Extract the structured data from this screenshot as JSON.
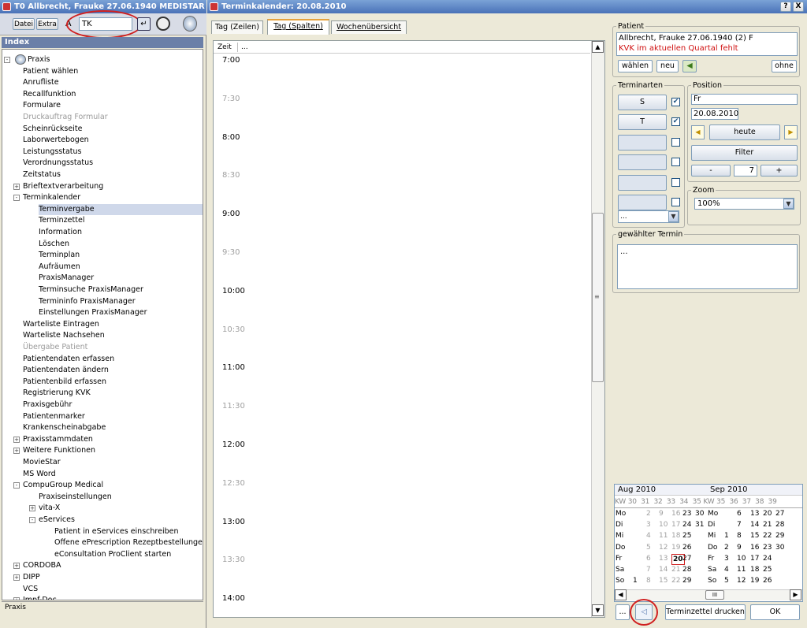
{
  "left_window": {
    "title": "T0 Allbrecht, Frauke 27.06.1940 MEDISTAR",
    "menu": [
      "Datei",
      "Extra"
    ],
    "search_value": "TK",
    "index_title": "Index",
    "status": "Praxis",
    "tree": [
      {
        "label": "Praxis",
        "level": 0,
        "expand": "-",
        "icon": "globe-icon"
      },
      {
        "label": "Patient wählen",
        "level": 1
      },
      {
        "label": "Anrufliste",
        "level": 1
      },
      {
        "label": "Recallfunktion",
        "level": 1
      },
      {
        "label": "Formulare",
        "level": 1
      },
      {
        "label": "Druckauftrag Formular",
        "level": 1,
        "disabled": true
      },
      {
        "label": "Scheinrückseite",
        "level": 1
      },
      {
        "label": "Laborwertebogen",
        "level": 1
      },
      {
        "label": "Leistungsstatus",
        "level": 1
      },
      {
        "label": "Verordnungsstatus",
        "level": 1
      },
      {
        "label": "Zeitstatus",
        "level": 1
      },
      {
        "label": "Brieftextverarbeitung",
        "level": 1,
        "expand": "+"
      },
      {
        "label": "Terminkalender",
        "level": 1,
        "expand": "-"
      },
      {
        "label": "Terminvergabe",
        "level": 2,
        "selected": true
      },
      {
        "label": "Terminzettel",
        "level": 2
      },
      {
        "label": "Information",
        "level": 2
      },
      {
        "label": "Löschen",
        "level": 2
      },
      {
        "label": "Terminplan",
        "level": 2
      },
      {
        "label": "Aufräumen",
        "level": 2
      },
      {
        "label": "PraxisManager",
        "level": 2
      },
      {
        "label": "Terminsuche PraxisManager",
        "level": 2
      },
      {
        "label": "Termininfo PraxisManager",
        "level": 2
      },
      {
        "label": "Einstellungen PraxisManager",
        "level": 2
      },
      {
        "label": "Warteliste Eintragen",
        "level": 1
      },
      {
        "label": "Warteliste Nachsehen",
        "level": 1
      },
      {
        "label": "Übergabe Patient",
        "level": 1,
        "disabled": true
      },
      {
        "label": "Patientendaten erfassen",
        "level": 1
      },
      {
        "label": "Patientendaten ändern",
        "level": 1
      },
      {
        "label": "Patientenbild erfassen",
        "level": 1
      },
      {
        "label": "Registrierung KVK",
        "level": 1
      },
      {
        "label": "Praxisgebühr",
        "level": 1
      },
      {
        "label": "Patientenmarker",
        "level": 1
      },
      {
        "label": "Krankenscheinabgabe",
        "level": 1
      },
      {
        "label": "Praxisstammdaten",
        "level": 1,
        "expand": "+"
      },
      {
        "label": "Weitere Funktionen",
        "level": 1,
        "expand": "+"
      },
      {
        "label": "MovieStar",
        "level": 1
      },
      {
        "label": "MS Word",
        "level": 1
      },
      {
        "label": "CompuGroup Medical",
        "level": 1,
        "expand": "-"
      },
      {
        "label": "Praxiseinstellungen",
        "level": 2
      },
      {
        "label": "vita-X",
        "level": 2,
        "expand": "+"
      },
      {
        "label": "eServices",
        "level": 2,
        "expand": "-"
      },
      {
        "label": "Patient in eServices einschreiben",
        "level": 3
      },
      {
        "label": "Offene ePrescription Rezeptbestellungen",
        "level": 3
      },
      {
        "label": "eConsultation ProClient starten",
        "level": 3
      },
      {
        "label": "CORDOBA",
        "level": 1,
        "expand": "+"
      },
      {
        "label": "DIPP",
        "level": 1,
        "expand": "+"
      },
      {
        "label": "VCS",
        "level": 1
      },
      {
        "label": "Impf-Doc",
        "level": 1,
        "expand": "+"
      }
    ]
  },
  "calendar_window": {
    "title": "Terminkalender: 20.08.2010",
    "help": "?",
    "close": "X",
    "tabs": [
      "Tag (Zeilen)",
      "Tag (Spalten)",
      "Wochenübersicht"
    ],
    "active_tab": 1,
    "grid_header": [
      "Zeit",
      "..."
    ],
    "times": [
      "7:00",
      "7:30",
      "8:00",
      "8:30",
      "9:00",
      "9:30",
      "10:00",
      "10:30",
      "11:00",
      "11:30",
      "12:00",
      "12:30",
      "13:00",
      "13:30",
      "14:00"
    ],
    "patient": {
      "legend": "Patient",
      "name": "Allbrecht, Frauke 27.06.1940 (2) F",
      "warning": "KVK im aktuellen Quartal fehlt",
      "btn_waehlen": "wählen",
      "btn_neu": "neu",
      "btn_ohne": "ohne"
    },
    "terminarten": {
      "legend": "Terminarten",
      "items": [
        {
          "label": "S",
          "checked": true
        },
        {
          "label": "T",
          "checked": true
        },
        {
          "label": "",
          "checked": false
        },
        {
          "label": "",
          "checked": false
        },
        {
          "label": "",
          "checked": false
        },
        {
          "label": "",
          "checked": false
        }
      ],
      "dropdown": "..."
    },
    "position": {
      "legend": "Position",
      "day": "Fr",
      "date": "20.08.2010",
      "heute": "heute",
      "filter": "Filter",
      "minus": "-",
      "count": "7",
      "plus": "+"
    },
    "zoom": {
      "legend": "Zoom",
      "value": "100%"
    },
    "selected_appt": {
      "legend": "gewählter Termin",
      "text": "..."
    },
    "minical": {
      "months": [
        "Aug 2010",
        "Sep 2010"
      ],
      "kw_row": "KW 30  31  32  33  34  35 KW 35  36  37  38  39",
      "rows": [
        {
          "day": "Mo",
          "aug": [
            " ",
            "2",
            "9",
            "16",
            "23",
            "30"
          ],
          "sep": [
            "",
            "6",
            "13",
            "20",
            "27"
          ]
        },
        {
          "day": "Di",
          "aug": [
            " ",
            "3",
            "10",
            "17",
            "24",
            "31"
          ],
          "sep": [
            "",
            "7",
            "14",
            "21",
            "28"
          ]
        },
        {
          "day": "Mi",
          "aug": [
            " ",
            "4",
            "11",
            "18",
            "25",
            ""
          ],
          "sep": [
            "1",
            "8",
            "15",
            "22",
            "29"
          ]
        },
        {
          "day": "Do",
          "aug": [
            " ",
            "5",
            "12",
            "19",
            "26",
            ""
          ],
          "sep": [
            "2",
            "9",
            "16",
            "23",
            "30"
          ]
        },
        {
          "day": "Fr",
          "aug": [
            " ",
            "6",
            "13",
            "20",
            "27",
            ""
          ],
          "sep": [
            "3",
            "10",
            "17",
            "24",
            ""
          ]
        },
        {
          "day": "Sa",
          "aug": [
            " ",
            "7",
            "14",
            "21",
            "28",
            ""
          ],
          "sep": [
            "4",
            "11",
            "18",
            "25",
            ""
          ]
        },
        {
          "day": "So",
          "aug": [
            "1",
            "8",
            "15",
            "22",
            "29",
            ""
          ],
          "sep": [
            "5",
            "12",
            "19",
            "26",
            ""
          ]
        }
      ]
    },
    "bottom": {
      "dots": "...",
      "print": "Terminzettel drucken",
      "ok": "OK"
    }
  }
}
